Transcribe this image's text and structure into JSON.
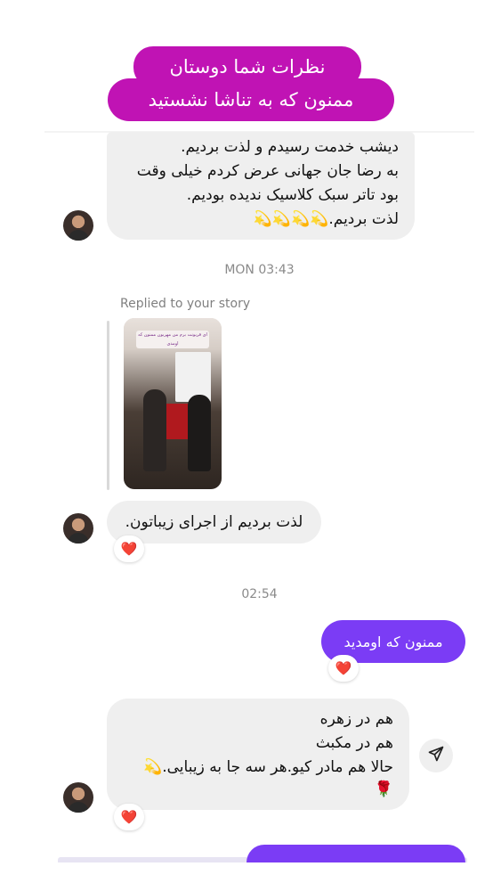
{
  "overlay": {
    "line1": "نظرات شما دوستان",
    "line2": "ممنون که به تناشا نشستید"
  },
  "messages": {
    "first": {
      "lines": [
        "دیشب خدمت رسیدم و لذت بردیم.",
        "به رضا جان جهانی عرض کردم خیلی وقت",
        "بود تاتر  سبک کلاسیک ندیده بودیم.",
        "لذت بردیم.💫💫💫💫"
      ]
    },
    "timestamp_1": "MON 03:43",
    "reply_label": "Replied to your story",
    "story_caption": "ای قربونت برم من مهربون ممنون که اومدی",
    "second": {
      "text": "لذت بردیم از اجرای زیباتون.",
      "reaction": "❤️"
    },
    "timestamp_2": "02:54",
    "sent": {
      "text": "ممنون که اومدید",
      "reaction": "❤️"
    },
    "third": {
      "lines": [
        "هم در زهره",
        "هم در مکبث",
        "حالا هم مادر کیو.هر سه جا به زیبایی.💫",
        "🌹"
      ],
      "reaction": "❤️"
    }
  },
  "icons": {
    "share": "paper-plane-icon",
    "avatar": "avatar"
  },
  "colors": {
    "overlay_bg": "#c013b4",
    "sent_bubble": "#7b3cf5",
    "received_bubble": "#efefef",
    "reaction_heart": "#e5132b"
  }
}
